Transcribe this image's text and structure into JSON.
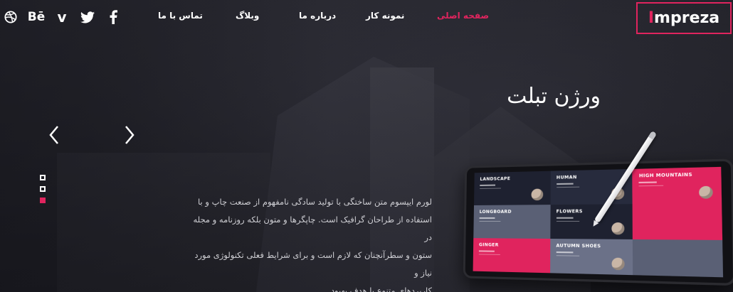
{
  "brand": {
    "logo_lead": "I",
    "logo_rest": "mpreza"
  },
  "nav": [
    {
      "label": "صفحه اصلی",
      "active": true
    },
    {
      "label": "نمونه کار",
      "active": false
    },
    {
      "label": "درباره ما",
      "active": false
    },
    {
      "label": "وبلاگ",
      "active": false
    },
    {
      "label": "تماس با ما",
      "active": false
    }
  ],
  "social": [
    {
      "icon": "facebook-icon"
    },
    {
      "icon": "twitter-icon"
    },
    {
      "icon": "vimeo-icon",
      "text": "v"
    },
    {
      "icon": "behance-icon",
      "text": "Bē"
    },
    {
      "icon": "dribbble-icon"
    }
  ],
  "slider": {
    "title": "ورژن تبلت",
    "text_lines": [
      "لورم ایپسوم متن ساختگی با تولید سادگی نامفهوم از صنعت چاپ و با",
      "استفاده از طراحان گرافیک است. چاپگرها و متون بلکه روزنامه و مجله در",
      "ستون و سطرآنچنان که لازم است و برای شرایط فعلی تکنولوژی مورد نیاز و",
      "کاربردهای متنوع با هدف بهبود ."
    ],
    "dots": [
      {
        "active": false
      },
      {
        "active": false
      },
      {
        "active": true
      }
    ],
    "prev_icon": "chevron-left-icon",
    "next_icon": "chevron-right-icon"
  },
  "tablet_tiles": [
    {
      "label": "LANDSCAPE",
      "style": "t-dark"
    },
    {
      "label": "HUMAN",
      "style": "t-dark2"
    },
    {
      "label": "HIGH MOUNTAINS",
      "style": "t-pink"
    },
    {
      "label": "LONGBOARD",
      "style": "t-slate"
    },
    {
      "label": "FLOWERS",
      "style": "t-dark"
    },
    {
      "label": "",
      "style": "t-pink"
    },
    {
      "label": "GINGER",
      "style": "t-pink"
    },
    {
      "label": "AUTUMN SHOES",
      "style": "t-slate2"
    },
    {
      "label": "",
      "style": "t-slate"
    }
  ],
  "colors": {
    "accent": "#e0245e",
    "background": "#24242b"
  }
}
